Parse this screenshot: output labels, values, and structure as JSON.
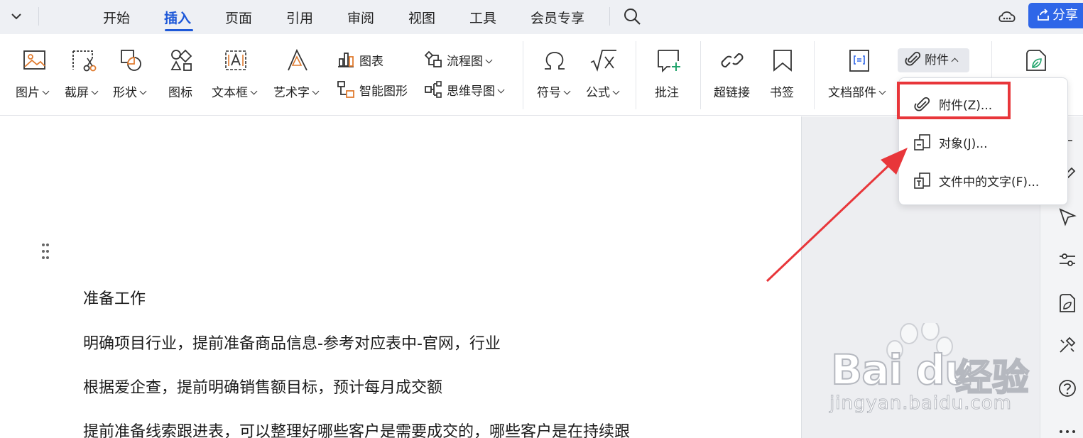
{
  "menubar": {
    "tabs": [
      {
        "label": "开始"
      },
      {
        "label": "插入"
      },
      {
        "label": "页面"
      },
      {
        "label": "引用"
      },
      {
        "label": "审阅"
      },
      {
        "label": "视图"
      },
      {
        "label": "工具"
      },
      {
        "label": "会员专享"
      }
    ],
    "active_tab": "插入",
    "share_label": "分享"
  },
  "ribbon": {
    "picture": "图片",
    "screenshot": "截屏",
    "shape": "形状",
    "icon": "图标",
    "textbox": "文本框",
    "wordart": "艺术字",
    "chart": "图表",
    "smartart": "智能图形",
    "flowchart": "流程图",
    "mindmap": "思维导图",
    "symbol": "符号",
    "formula": "公式",
    "comment": "批注",
    "hyperlink": "超链接",
    "bookmark": "书签",
    "doc_parts": "文档部件",
    "attachment": "附件"
  },
  "dropdown": {
    "items": [
      {
        "label": "附件(Z)..."
      },
      {
        "label": "对象(J)..."
      },
      {
        "label": "文件中的文字(F)..."
      }
    ]
  },
  "document": {
    "paragraphs": [
      "准备工作",
      "明确项目行业，提前准备商品信息-参考对应表中-官网，行业",
      "根据爱企查，提前明确销售额目标，预计每月成交额",
      "提前准备线索跟进表，可以整理好哪些客户是需要成交的，哪些客户是在持续跟"
    ]
  },
  "watermark": {
    "brand": "Bai du",
    "brand_cn": "经验",
    "url": "jingyan.baidu.com"
  },
  "colors": {
    "accent": "#1d58d8",
    "share_bg": "#2e66e8",
    "highlight": "#e8363a"
  }
}
